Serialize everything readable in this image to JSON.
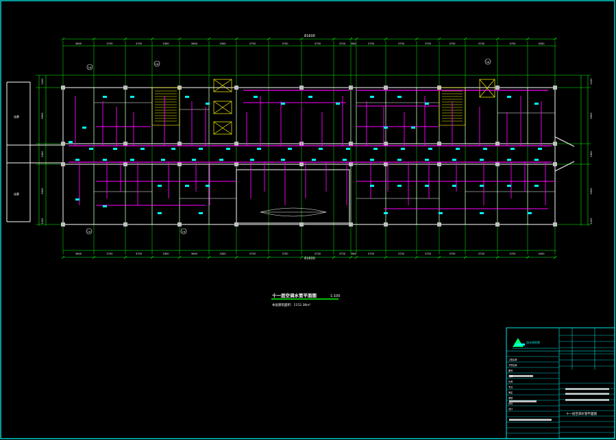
{
  "drawing": {
    "title": "十一层空调水管平面图",
    "scale": "1:100",
    "subtitle": "本层建筑面积：1152.38m²",
    "overall_dim_top": "81600",
    "overall_dim_bottom": "81600",
    "top_dims": [
      "3600",
      "3750",
      "3750",
      "3300",
      "3600",
      "3300",
      "3750",
      "3750",
      "3750",
      "3750",
      "600",
      "3750",
      "3750",
      "3750",
      "3750",
      "3750",
      "3750",
      "3450"
    ],
    "bottom_dims": [
      "3600",
      "3750",
      "3750",
      "3300",
      "3600",
      "3300",
      "3750",
      "3750",
      "3750",
      "3750",
      "600",
      "3750",
      "3750",
      "3750",
      "3750",
      "3750",
      "3750",
      "3450"
    ],
    "left_dims": [
      "1200",
      "6900",
      "2400",
      "6900",
      "1200"
    ],
    "right_dims": [
      "1200",
      "6900",
      "2400",
      "6900",
      "1200"
    ],
    "left_annex_labels": [
      "连廊",
      "连廊"
    ],
    "room_tags": [
      "1#",
      "2#",
      "1#",
      "2#",
      "3#"
    ]
  },
  "title_block": {
    "company": "设计研究院",
    "drawing_name": "十一层空调水管平面图",
    "rows": [
      "工程名称",
      "子项名称",
      "图号",
      "日期",
      "比例",
      "专业",
      "审定",
      "审核",
      "校对",
      "设计"
    ]
  },
  "colors": {
    "background": "#000000",
    "frame": "#00ffff",
    "grid": "#00ff00",
    "walls": "#ffffff",
    "pipes": "#ff00ff",
    "equipment": "#00ffff",
    "stairs": "#ffff00",
    "labels": "#ffffff"
  }
}
